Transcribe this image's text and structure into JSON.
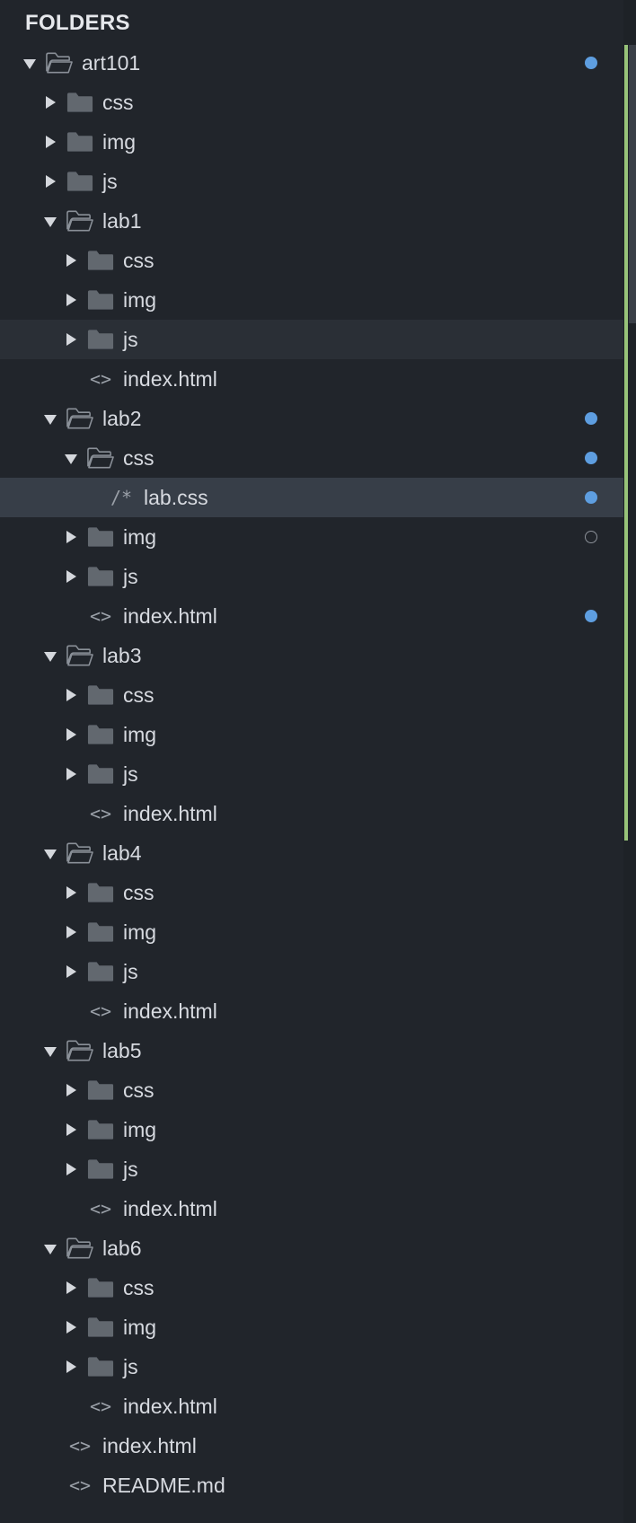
{
  "header": {
    "title": "FOLDERS"
  },
  "colors": {
    "background": "#21252b",
    "selected_row": "#373e48",
    "hover_row": "#2a2f36",
    "modified_dot": "#5e9ee0",
    "scroll_git_bar": "#98c379"
  },
  "icons": {
    "folder": "folder-icon",
    "folder_open": "folder-open-icon",
    "html_file": "code-brackets-icon",
    "css_file": "comment-icon",
    "modified_marker": "dot-icon",
    "untracked_marker": "hollow-dot-icon"
  },
  "tree": [
    {
      "label": "art101",
      "level": 0,
      "type": "folder",
      "expanded": true,
      "status": "modified"
    },
    {
      "label": "css",
      "level": 1,
      "type": "folder",
      "expanded": false
    },
    {
      "label": "img",
      "level": 1,
      "type": "folder",
      "expanded": false
    },
    {
      "label": "js",
      "level": 1,
      "type": "folder",
      "expanded": false
    },
    {
      "label": "lab1",
      "level": 1,
      "type": "folder",
      "expanded": true
    },
    {
      "label": "css",
      "level": 2,
      "type": "folder",
      "expanded": false
    },
    {
      "label": "img",
      "level": 2,
      "type": "folder",
      "expanded": false
    },
    {
      "label": "js",
      "level": 2,
      "type": "folder",
      "expanded": false,
      "hover": true
    },
    {
      "label": "index.html",
      "level": 2,
      "type": "file",
      "icon": "<>"
    },
    {
      "label": "lab2",
      "level": 1,
      "type": "folder",
      "expanded": true,
      "status": "modified"
    },
    {
      "label": "css",
      "level": 2,
      "type": "folder",
      "expanded": true,
      "status": "modified"
    },
    {
      "label": "lab.css",
      "level": 3,
      "type": "file",
      "icon": "/*",
      "selected": true,
      "status": "modified"
    },
    {
      "label": "img",
      "level": 2,
      "type": "folder",
      "expanded": false,
      "status": "untracked"
    },
    {
      "label": "js",
      "level": 2,
      "type": "folder",
      "expanded": false
    },
    {
      "label": "index.html",
      "level": 2,
      "type": "file",
      "icon": "<>",
      "status": "modified"
    },
    {
      "label": "lab3",
      "level": 1,
      "type": "folder",
      "expanded": true
    },
    {
      "label": "css",
      "level": 2,
      "type": "folder",
      "expanded": false
    },
    {
      "label": "img",
      "level": 2,
      "type": "folder",
      "expanded": false
    },
    {
      "label": "js",
      "level": 2,
      "type": "folder",
      "expanded": false
    },
    {
      "label": "index.html",
      "level": 2,
      "type": "file",
      "icon": "<>"
    },
    {
      "label": "lab4",
      "level": 1,
      "type": "folder",
      "expanded": true
    },
    {
      "label": "css",
      "level": 2,
      "type": "folder",
      "expanded": false
    },
    {
      "label": "img",
      "level": 2,
      "type": "folder",
      "expanded": false
    },
    {
      "label": "js",
      "level": 2,
      "type": "folder",
      "expanded": false
    },
    {
      "label": "index.html",
      "level": 2,
      "type": "file",
      "icon": "<>"
    },
    {
      "label": "lab5",
      "level": 1,
      "type": "folder",
      "expanded": true
    },
    {
      "label": "css",
      "level": 2,
      "type": "folder",
      "expanded": false
    },
    {
      "label": "img",
      "level": 2,
      "type": "folder",
      "expanded": false
    },
    {
      "label": "js",
      "level": 2,
      "type": "folder",
      "expanded": false
    },
    {
      "label": "index.html",
      "level": 2,
      "type": "file",
      "icon": "<>"
    },
    {
      "label": "lab6",
      "level": 1,
      "type": "folder",
      "expanded": true
    },
    {
      "label": "css",
      "level": 2,
      "type": "folder",
      "expanded": false
    },
    {
      "label": "img",
      "level": 2,
      "type": "folder",
      "expanded": false
    },
    {
      "label": "js",
      "level": 2,
      "type": "folder",
      "expanded": false
    },
    {
      "label": "index.html",
      "level": 2,
      "type": "file",
      "icon": "<>"
    },
    {
      "label": "index.html",
      "level": 1,
      "type": "file",
      "icon": "<>"
    },
    {
      "label": "README.md",
      "level": 1,
      "type": "file",
      "icon": "<>"
    }
  ]
}
